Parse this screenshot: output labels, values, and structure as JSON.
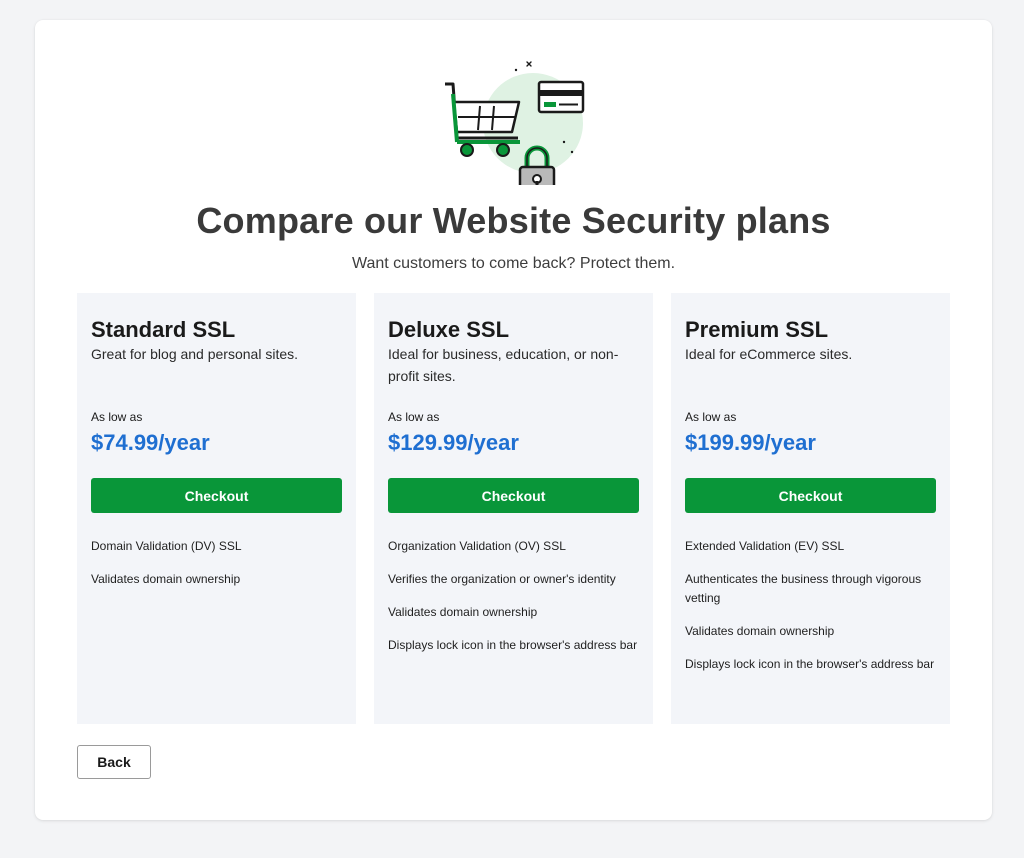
{
  "header": {
    "title": "Compare our Website Security plans",
    "subtitle": "Want customers to come back? Protect them."
  },
  "plans": [
    {
      "name": "Standard SSL",
      "description": "Great for blog and personal sites.",
      "price_prefix": "As low as",
      "price": "$74.99/year",
      "button_label": "Checkout",
      "features": [
        "Domain Validation (DV) SSL",
        "Validates domain ownership"
      ]
    },
    {
      "name": "Deluxe SSL",
      "description": "Ideal for business, education, or non-profit sites.",
      "price_prefix": "As low as",
      "price": "$129.99/year",
      "button_label": "Checkout",
      "features": [
        "Organization Validation (OV) SSL",
        "Verifies the organization or owner's identity",
        "Validates domain ownership",
        "Displays lock icon in the browser's address bar"
      ]
    },
    {
      "name": "Premium SSL",
      "description": "Ideal for eCommerce sites.",
      "price_prefix": "As low as",
      "price": "$199.99/year",
      "button_label": "Checkout",
      "features": [
        "Extended Validation (EV) SSL",
        "Authenticates the business through vigorous vetting",
        "Validates domain ownership",
        "Displays lock icon in the browser's address bar"
      ]
    }
  ],
  "footer": {
    "back_label": "Back"
  },
  "colors": {
    "accent_green": "#099639",
    "price_blue": "#1f6fd1",
    "plan_background": "#f3f5f9",
    "page_background": "#f3f4f6"
  },
  "icons": [
    "shopping-cart-icon",
    "credit-card-icon",
    "padlock-icon"
  ]
}
